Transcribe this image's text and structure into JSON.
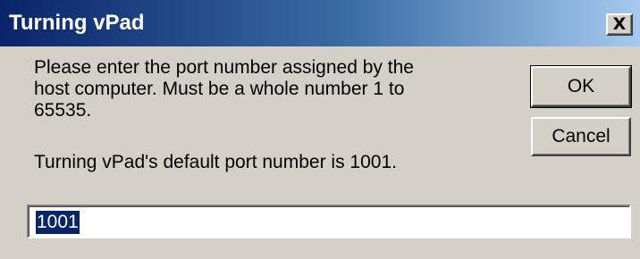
{
  "window": {
    "title": "Turning vPad",
    "close_label": "X"
  },
  "message": {
    "prompt": "Please enter the port number assigned by the\nhost computer.  Must be a whole number 1 to\n65535.",
    "default_note": "Turning vPad's default port number is 1001."
  },
  "buttons": {
    "ok_label": "OK",
    "cancel_label": "Cancel"
  },
  "port_input": {
    "value": "1001",
    "selected": true
  },
  "colors": {
    "titlebar_start": "#0a246a",
    "titlebar_end": "#a6caf0",
    "dialog_background": "#d4d0c8",
    "selection": "#0a246a"
  },
  "icons": {
    "close": "close-icon"
  }
}
